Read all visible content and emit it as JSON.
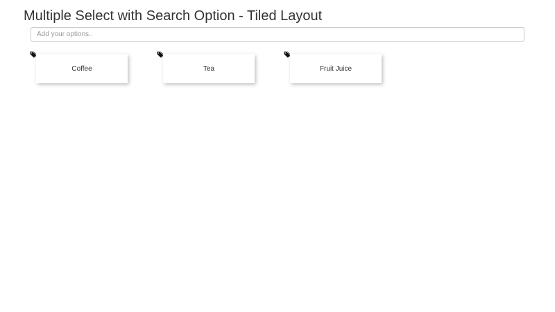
{
  "title": "Multiple Select with Search Option - Tiled Layout",
  "search": {
    "placeholder": "Add your options..",
    "value": ""
  },
  "options": [
    {
      "label": "Coffee",
      "icon": "tags-icon"
    },
    {
      "label": "Tea",
      "icon": "tags-icon"
    },
    {
      "label": "Fruit Juice",
      "icon": "tags-icon"
    }
  ]
}
